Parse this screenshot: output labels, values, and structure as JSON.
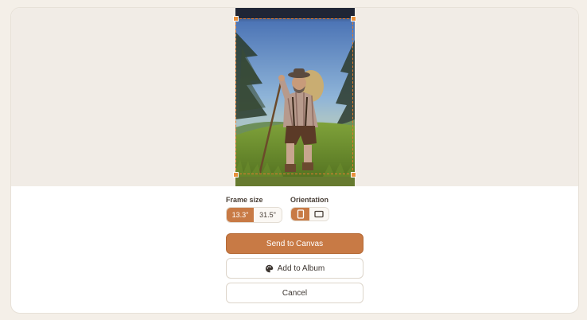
{
  "frame_size": {
    "label": "Frame size",
    "options": [
      "13.3\"",
      "31.5\""
    ],
    "selected": "13.3\""
  },
  "orientation": {
    "label": "Orientation",
    "options": [
      "portrait-icon",
      "landscape-icon"
    ],
    "selected": "portrait"
  },
  "buttons": {
    "send_label": "Send to Canvas",
    "album_label": "Add to Album",
    "cancel_label": "Cancel"
  },
  "colors": {
    "accent": "#c87a45",
    "crop_border": "#e07a2e"
  }
}
